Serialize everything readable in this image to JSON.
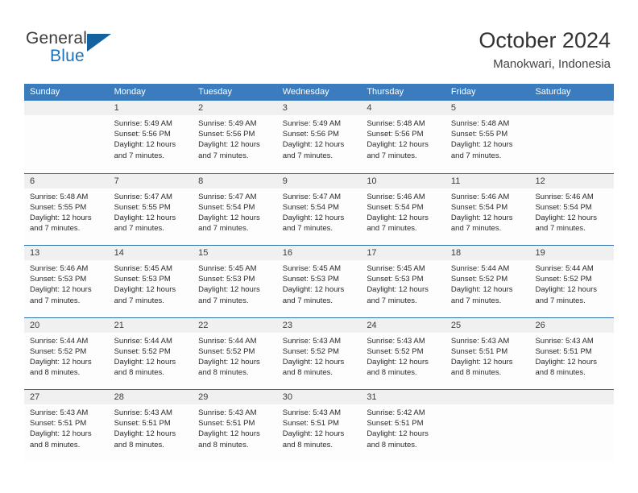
{
  "brand": {
    "name_part1": "General",
    "name_part2": "Blue",
    "logo_icon": "triangle-sail-icon",
    "accent_color": "#1b72b8"
  },
  "header": {
    "title": "October 2024",
    "subtitle": "Manokwari, Indonesia"
  },
  "theme": {
    "header_row_bg": "#3a7cbe",
    "row_divider": "#2f6ea8",
    "daynum_bg": "#f0f0f0",
    "cell_bg": "#fdfdfd",
    "text": "#2b2b2b"
  },
  "calendar": {
    "day_headers": [
      "Sunday",
      "Monday",
      "Tuesday",
      "Wednesday",
      "Thursday",
      "Friday",
      "Saturday"
    ],
    "weeks": [
      [
        {
          "day": "",
          "empty": true,
          "sunrise": "",
          "sunset": "",
          "daylight_line1": "",
          "daylight_line2": ""
        },
        {
          "day": "1",
          "empty": false,
          "sunrise": "Sunrise: 5:49 AM",
          "sunset": "Sunset: 5:56 PM",
          "daylight_line1": "Daylight: 12 hours",
          "daylight_line2": "and 7 minutes."
        },
        {
          "day": "2",
          "empty": false,
          "sunrise": "Sunrise: 5:49 AM",
          "sunset": "Sunset: 5:56 PM",
          "daylight_line1": "Daylight: 12 hours",
          "daylight_line2": "and 7 minutes."
        },
        {
          "day": "3",
          "empty": false,
          "sunrise": "Sunrise: 5:49 AM",
          "sunset": "Sunset: 5:56 PM",
          "daylight_line1": "Daylight: 12 hours",
          "daylight_line2": "and 7 minutes."
        },
        {
          "day": "4",
          "empty": false,
          "sunrise": "Sunrise: 5:48 AM",
          "sunset": "Sunset: 5:56 PM",
          "daylight_line1": "Daylight: 12 hours",
          "daylight_line2": "and 7 minutes."
        },
        {
          "day": "5",
          "empty": false,
          "sunrise": "Sunrise: 5:48 AM",
          "sunset": "Sunset: 5:55 PM",
          "daylight_line1": "Daylight: 12 hours",
          "daylight_line2": "and 7 minutes."
        },
        {
          "day": "",
          "empty": true,
          "sunrise": "",
          "sunset": "",
          "daylight_line1": "",
          "daylight_line2": ""
        }
      ],
      [
        {
          "day": "6",
          "empty": false,
          "sunrise": "Sunrise: 5:48 AM",
          "sunset": "Sunset: 5:55 PM",
          "daylight_line1": "Daylight: 12 hours",
          "daylight_line2": "and 7 minutes."
        },
        {
          "day": "7",
          "empty": false,
          "sunrise": "Sunrise: 5:47 AM",
          "sunset": "Sunset: 5:55 PM",
          "daylight_line1": "Daylight: 12 hours",
          "daylight_line2": "and 7 minutes."
        },
        {
          "day": "8",
          "empty": false,
          "sunrise": "Sunrise: 5:47 AM",
          "sunset": "Sunset: 5:54 PM",
          "daylight_line1": "Daylight: 12 hours",
          "daylight_line2": "and 7 minutes."
        },
        {
          "day": "9",
          "empty": false,
          "sunrise": "Sunrise: 5:47 AM",
          "sunset": "Sunset: 5:54 PM",
          "daylight_line1": "Daylight: 12 hours",
          "daylight_line2": "and 7 minutes."
        },
        {
          "day": "10",
          "empty": false,
          "sunrise": "Sunrise: 5:46 AM",
          "sunset": "Sunset: 5:54 PM",
          "daylight_line1": "Daylight: 12 hours",
          "daylight_line2": "and 7 minutes."
        },
        {
          "day": "11",
          "empty": false,
          "sunrise": "Sunrise: 5:46 AM",
          "sunset": "Sunset: 5:54 PM",
          "daylight_line1": "Daylight: 12 hours",
          "daylight_line2": "and 7 minutes."
        },
        {
          "day": "12",
          "empty": false,
          "sunrise": "Sunrise: 5:46 AM",
          "sunset": "Sunset: 5:54 PM",
          "daylight_line1": "Daylight: 12 hours",
          "daylight_line2": "and 7 minutes."
        }
      ],
      [
        {
          "day": "13",
          "empty": false,
          "sunrise": "Sunrise: 5:46 AM",
          "sunset": "Sunset: 5:53 PM",
          "daylight_line1": "Daylight: 12 hours",
          "daylight_line2": "and 7 minutes."
        },
        {
          "day": "14",
          "empty": false,
          "sunrise": "Sunrise: 5:45 AM",
          "sunset": "Sunset: 5:53 PM",
          "daylight_line1": "Daylight: 12 hours",
          "daylight_line2": "and 7 minutes."
        },
        {
          "day": "15",
          "empty": false,
          "sunrise": "Sunrise: 5:45 AM",
          "sunset": "Sunset: 5:53 PM",
          "daylight_line1": "Daylight: 12 hours",
          "daylight_line2": "and 7 minutes."
        },
        {
          "day": "16",
          "empty": false,
          "sunrise": "Sunrise: 5:45 AM",
          "sunset": "Sunset: 5:53 PM",
          "daylight_line1": "Daylight: 12 hours",
          "daylight_line2": "and 7 minutes."
        },
        {
          "day": "17",
          "empty": false,
          "sunrise": "Sunrise: 5:45 AM",
          "sunset": "Sunset: 5:53 PM",
          "daylight_line1": "Daylight: 12 hours",
          "daylight_line2": "and 7 minutes."
        },
        {
          "day": "18",
          "empty": false,
          "sunrise": "Sunrise: 5:44 AM",
          "sunset": "Sunset: 5:52 PM",
          "daylight_line1": "Daylight: 12 hours",
          "daylight_line2": "and 7 minutes."
        },
        {
          "day": "19",
          "empty": false,
          "sunrise": "Sunrise: 5:44 AM",
          "sunset": "Sunset: 5:52 PM",
          "daylight_line1": "Daylight: 12 hours",
          "daylight_line2": "and 7 minutes."
        }
      ],
      [
        {
          "day": "20",
          "empty": false,
          "sunrise": "Sunrise: 5:44 AM",
          "sunset": "Sunset: 5:52 PM",
          "daylight_line1": "Daylight: 12 hours",
          "daylight_line2": "and 8 minutes."
        },
        {
          "day": "21",
          "empty": false,
          "sunrise": "Sunrise: 5:44 AM",
          "sunset": "Sunset: 5:52 PM",
          "daylight_line1": "Daylight: 12 hours",
          "daylight_line2": "and 8 minutes."
        },
        {
          "day": "22",
          "empty": false,
          "sunrise": "Sunrise: 5:44 AM",
          "sunset": "Sunset: 5:52 PM",
          "daylight_line1": "Daylight: 12 hours",
          "daylight_line2": "and 8 minutes."
        },
        {
          "day": "23",
          "empty": false,
          "sunrise": "Sunrise: 5:43 AM",
          "sunset": "Sunset: 5:52 PM",
          "daylight_line1": "Daylight: 12 hours",
          "daylight_line2": "and 8 minutes."
        },
        {
          "day": "24",
          "empty": false,
          "sunrise": "Sunrise: 5:43 AM",
          "sunset": "Sunset: 5:52 PM",
          "daylight_line1": "Daylight: 12 hours",
          "daylight_line2": "and 8 minutes."
        },
        {
          "day": "25",
          "empty": false,
          "sunrise": "Sunrise: 5:43 AM",
          "sunset": "Sunset: 5:51 PM",
          "daylight_line1": "Daylight: 12 hours",
          "daylight_line2": "and 8 minutes."
        },
        {
          "day": "26",
          "empty": false,
          "sunrise": "Sunrise: 5:43 AM",
          "sunset": "Sunset: 5:51 PM",
          "daylight_line1": "Daylight: 12 hours",
          "daylight_line2": "and 8 minutes."
        }
      ],
      [
        {
          "day": "27",
          "empty": false,
          "sunrise": "Sunrise: 5:43 AM",
          "sunset": "Sunset: 5:51 PM",
          "daylight_line1": "Daylight: 12 hours",
          "daylight_line2": "and 8 minutes."
        },
        {
          "day": "28",
          "empty": false,
          "sunrise": "Sunrise: 5:43 AM",
          "sunset": "Sunset: 5:51 PM",
          "daylight_line1": "Daylight: 12 hours",
          "daylight_line2": "and 8 minutes."
        },
        {
          "day": "29",
          "empty": false,
          "sunrise": "Sunrise: 5:43 AM",
          "sunset": "Sunset: 5:51 PM",
          "daylight_line1": "Daylight: 12 hours",
          "daylight_line2": "and 8 minutes."
        },
        {
          "day": "30",
          "empty": false,
          "sunrise": "Sunrise: 5:43 AM",
          "sunset": "Sunset: 5:51 PM",
          "daylight_line1": "Daylight: 12 hours",
          "daylight_line2": "and 8 minutes."
        },
        {
          "day": "31",
          "empty": false,
          "sunrise": "Sunrise: 5:42 AM",
          "sunset": "Sunset: 5:51 PM",
          "daylight_line1": "Daylight: 12 hours",
          "daylight_line2": "and 8 minutes."
        },
        {
          "day": "",
          "empty": true,
          "sunrise": "",
          "sunset": "",
          "daylight_line1": "",
          "daylight_line2": ""
        },
        {
          "day": "",
          "empty": true,
          "sunrise": "",
          "sunset": "",
          "daylight_line1": "",
          "daylight_line2": ""
        }
      ]
    ]
  }
}
